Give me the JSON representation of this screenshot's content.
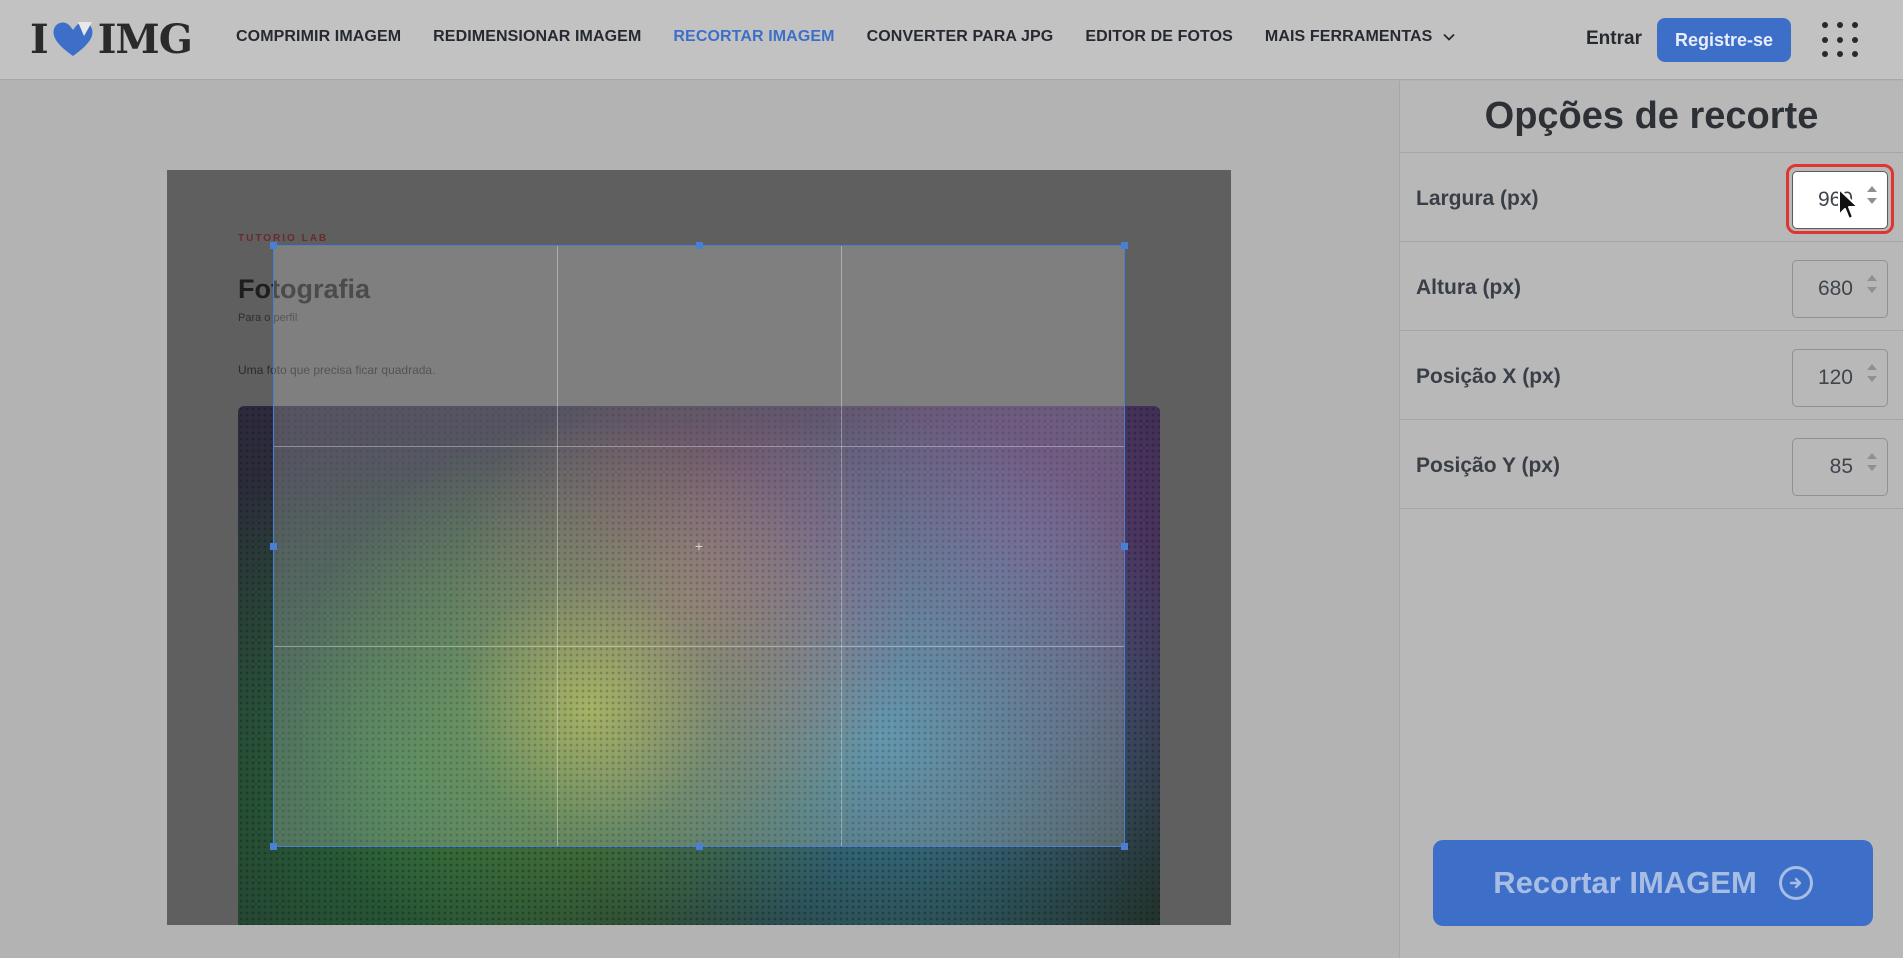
{
  "header": {
    "logo_left": "I",
    "logo_right": "IMG",
    "nav": [
      {
        "label": "COMPRIMIR IMAGEM"
      },
      {
        "label": "REDIMENSIONAR IMAGEM"
      },
      {
        "label": "RECORTAR IMAGEM"
      },
      {
        "label": "CONVERTER PARA JPG"
      },
      {
        "label": "EDITOR DE FOTOS"
      }
    ],
    "more_label": "MAIS FERRAMENTAS",
    "login_label": "Entrar",
    "register_label": "Registre-se",
    "accent_color": "#3d6fc9"
  },
  "document": {
    "tag": "TUTORIO LAB",
    "title": "Fotografia",
    "subtitle": "Para o perfil",
    "text": "Uma foto que precisa ficar quadrada."
  },
  "sidebar": {
    "title": "Opções de recorte",
    "fields": [
      {
        "label": "Largura (px)",
        "value": "960"
      },
      {
        "label": "Altura (px)",
        "value": "680"
      },
      {
        "label": "Posição X (px)",
        "value": "120"
      },
      {
        "label": "Posição Y (px)",
        "value": "85"
      }
    ],
    "action_label": "Recortar IMAGEM"
  },
  "icons": {
    "logo_heart": "heart-icon",
    "more_chevron": "chevron-down-icon",
    "apps_grid": "grid-icon",
    "action_arrow": "arrow-right-circle-icon",
    "cursor": "mouse-pointer-icon"
  }
}
